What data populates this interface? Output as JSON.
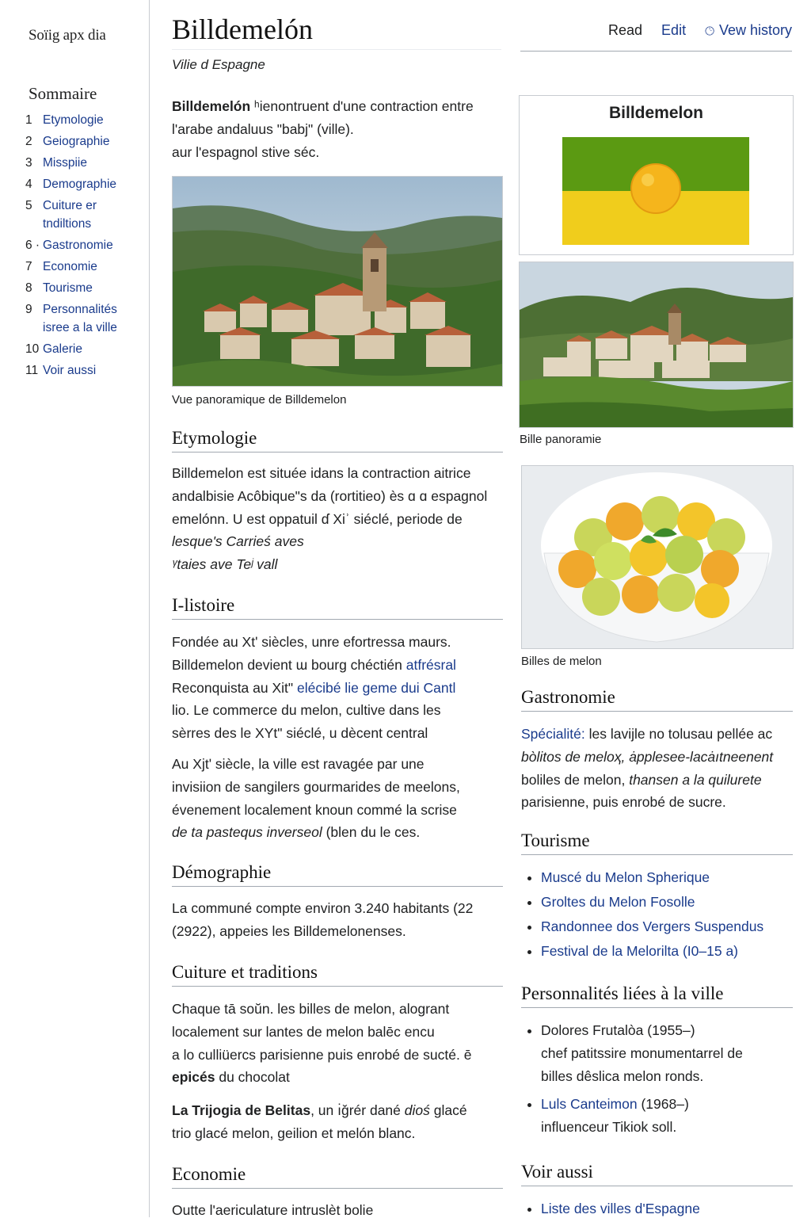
{
  "site": {
    "logo": "Soïig apx dia"
  },
  "toc": {
    "title": "Sommaire",
    "items": [
      {
        "num": "1",
        "label": "Etymologie"
      },
      {
        "num": "2",
        "label": "Geiographie"
      },
      {
        "num": "3",
        "label": "Misspiie"
      },
      {
        "num": "4",
        "label": "Demographie"
      },
      {
        "num": "5",
        "label": "Cuiture er tndiltions"
      },
      {
        "num": "6 ·",
        "label": "Gastronomie"
      },
      {
        "num": "7",
        "label": "Economie"
      },
      {
        "num": "8",
        "label": "Tourisme"
      },
      {
        "num": "9",
        "label": "Personnalités isree a la ville"
      },
      {
        "num": "10",
        "label": "Galerie"
      },
      {
        "num": "11",
        "label": "Voir aussi"
      }
    ]
  },
  "header": {
    "title": "Billdemelón",
    "subtitle": "Vilie d Espagne",
    "tabs": {
      "read": "Read",
      "edit": "Edit",
      "history": "Vew history"
    }
  },
  "intro": {
    "lead_bold": "Billdemelón",
    "lead_rest": " ʰienontruent d'une contraction entre l'arabe andaluus \"babj\" (ville).",
    "line3": "aur l'espagnol stive séc."
  },
  "main_photo": {
    "caption": "Vue panoramique de Billdemelon"
  },
  "etymology": {
    "heading": "Etymologie",
    "line1": "Billdemelon est située idans la contraction aitrice",
    "line2": "andalbisie Acôbique\"s da (rortitieo) ès ɑ ɑ espagnol",
    "line3": "emelónn. U est oppatuil ɗ Xiʾ siéclé, periode de",
    "line4": "lesque's Carrieś aves",
    "line5": "ᵞtaies ave Teʲ vall"
  },
  "history": {
    "heading": "I-listoire",
    "p1_l1": "Fondée au Xtʹ siècles, unre efortressa maurs.",
    "p1_l2a": "Billdemelon devient ɯ bourg chéctién ",
    "p1_l2b": "atfrésral",
    "p1_l3a": "Reconquista au Xit\" ",
    "p1_l3b": "elécibé lie geme dui Cantl",
    "p1_l4": "lio. Le commerce du melon, cultive dans les",
    "p1_l5": "sèrres des le XYt\" siéclé, u dècent central",
    "p2_l1": "Au Xjtʹ siècle, la ville est ravagée par une",
    "p2_l2": "invisiion de sangilers gourmarides de meelons,",
    "p2_l3": "évenement localement knoun commé la scrise",
    "p2_l4a": "de ta pastequs inverseol",
    "p2_l4b": " (blen du le ces."
  },
  "demography": {
    "heading": "Démographie",
    "l1": "La communé compte environ 3.240 habitants (22",
    "l2": "(2922), appeies les Billdemelonenses."
  },
  "culture": {
    "heading": "Cuiture et traditions",
    "p1_l1": "Chaque tā soŭn. les billes de melon, alogrant",
    "p1_l2": "localement sur lantes de melon balēc encu",
    "p1_l3": "a lo culliüercs parisienne puis enrobé de sucté. ē",
    "p1_l4a": "epicés",
    "p1_l4b": " du chocolat",
    "p2_l1a": "La Trijogia de Belitas",
    "p2_l1b": ", un ı̇ǧrér dané ",
    "p2_l1c": "dioś",
    "p2_l1d": " glacé",
    "p2_l2": "trio glacé melon, geilion et melón blanc."
  },
  "economy": {
    "heading": "Economie",
    "l1": "Outte l'aericulature intruslèt bolie"
  },
  "infobox": {
    "title": "Billdemelon",
    "flag_colors": {
      "top": "#5b9a12",
      "bottom": "#f0cd1c",
      "melon": "#f5b51c"
    }
  },
  "side_photo": {
    "caption": "Bille panoramie"
  },
  "melon_photo": {
    "caption": "Billes de melon"
  },
  "gastronomy": {
    "heading": "Gastronomie",
    "l1a": "Spécialité:",
    "l1b": " les lavijle no tolusau pellée ac",
    "l2a": "bòlitos de meloҳ",
    "l2b": ", ȧpplesee-lacȧıtneenent",
    "l3a": "boliles de melon, ",
    "l3b": "thansen a la quilurete",
    "l4": "parisienne, puis enrobé de sucre."
  },
  "tourism": {
    "heading": "Tourisme",
    "items": [
      "Muscé du Melon Spherique",
      "Groltes du Melon Fosolle",
      "Randonnee dos Vergers Suspendus",
      "Festival de la Melorilta (I0–15 a)"
    ]
  },
  "people": {
    "heading": "Personnalités liées à la ville",
    "p1_name": "Dolores Frutalòa",
    "p1_years": " (1955–)",
    "p1_l2": "chef patitssire monumentarrel de",
    "p1_l3": "billes dêslica melon ronds.",
    "p2_name": "Luls Canteimon",
    "p2_years": " (1968–)",
    "p2_l2": "influenceur Tikiok soll."
  },
  "see_also": {
    "heading": "Voir aussi",
    "items": [
      "Liste des villes d'Espagne"
    ]
  }
}
